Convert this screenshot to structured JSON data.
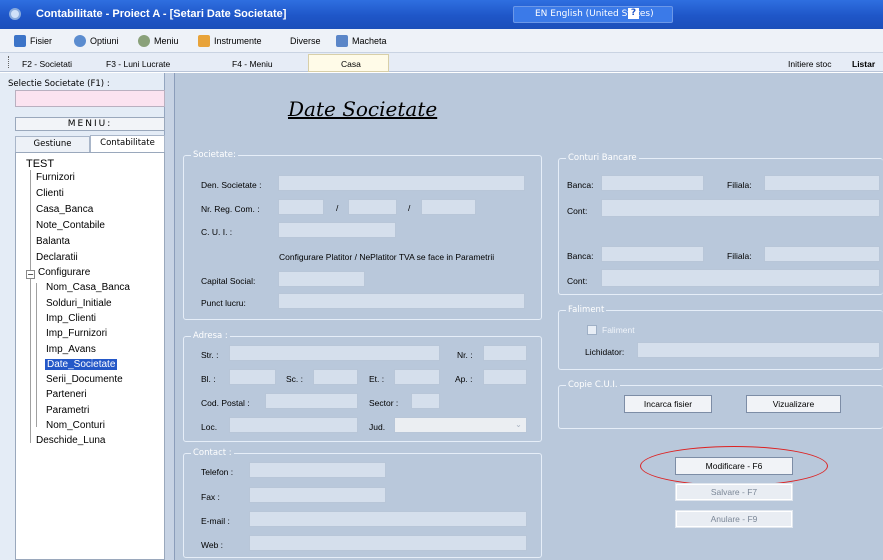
{
  "window": {
    "title": "Contabilitate - Proiect A  - [Setari Date Societate]",
    "language": "EN English (United States)",
    "help": "?"
  },
  "menubar": {
    "items": [
      "Fisier",
      "Optiuni",
      "Meniu",
      "Instrumente",
      "Diverse",
      "Macheta"
    ]
  },
  "tabs": {
    "items": [
      "F2 - Societati",
      "F3 - Luni Lucrate",
      "F4 - Meniu",
      "Casa"
    ],
    "right_1": "Initiere stoc",
    "right_2": "Listar"
  },
  "sidebar": {
    "selectie_label": "Selectie Societate (F1) :",
    "menu_header": "MENIU:",
    "tab_gestiune": "Gestiune",
    "tab_contabilitate": "Contabilitate",
    "tree": {
      "root": "TEST",
      "items": [
        "Furnizori",
        "Clienti",
        "Casa_Banca",
        "Note_Contabile",
        "Balanta",
        "Declaratii",
        "Configurare"
      ],
      "sub": [
        "Nom_Casa_Banca",
        "Solduri_Initiale",
        "Imp_Clienti",
        "Imp_Furnizori",
        "Imp_Avans",
        "Date_Societate",
        "Serii_Documente",
        "Parteneri",
        "Parametri",
        "Nom_Conturi"
      ],
      "last": "Deschide_Luna"
    }
  },
  "main": {
    "title": "Date Societate",
    "societate": {
      "legend": "Societate:",
      "den": "Den. Societate :",
      "nrreg": "Nr. Reg. Com. :",
      "slash": "/",
      "cui": "C. U. I. :",
      "note": "Configurare Platitor / NePlatitor TVA se face in Parametrii",
      "capital": "Capital Social:",
      "punct": "Punct lucru:"
    },
    "adresa": {
      "legend": "Adresa :",
      "str": "Str. :",
      "nr": "Nr. :",
      "bl": "Bl. :",
      "sc": "Sc. :",
      "et": "Et. :",
      "ap": "Ap. :",
      "cod": "Cod. Postal :",
      "sector": "Sector :",
      "loc": "Loc.",
      "jud": "Jud."
    },
    "contact": {
      "legend": "Contact :",
      "telefon": "Telefon :",
      "fax": "Fax :",
      "email": "E-mail :",
      "web": "Web :"
    },
    "conturi": {
      "legend": "Conturi Bancare",
      "banca": "Banca:",
      "filiala": "Filiala:",
      "cont": "Cont:"
    },
    "faliment": {
      "legend": "Faliment",
      "check": "Faliment",
      "lichidator": "Lichidator:"
    },
    "copie": {
      "legend": "Copie C.U.I.",
      "incarca": "Incarca fisier",
      "vizualizare": "Vizualizare"
    },
    "buttons": {
      "modificare": "Modificare   - F6",
      "salvare": "Salvare    - F7",
      "anulare": "Anulare    - F9"
    }
  },
  "colors": {
    "titlebar": "#1f56c8",
    "main_bg": "#b9c8db",
    "field_bg": "#d5dfec",
    "selection": "#2458c8",
    "highlight_oval": "#dd2222"
  }
}
